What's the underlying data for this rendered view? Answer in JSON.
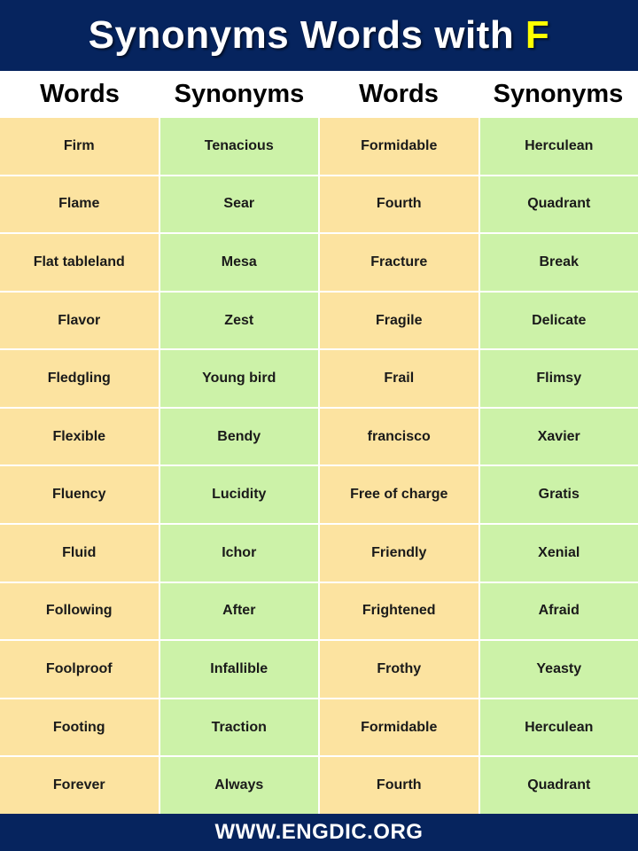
{
  "header": {
    "title_main": "Synonyms Words with ",
    "title_accent": "F",
    "background_color": "#06245e",
    "text_color": "#ffffff",
    "accent_color": "#ffff00"
  },
  "table": {
    "columns": [
      "Words",
      "Synonyms",
      "Words",
      "Synonyms"
    ],
    "word_cell_color": "#fce3a0",
    "synonym_cell_color": "#ccf2a8",
    "rows": [
      {
        "word1": "Firm",
        "synonym1": "Tenacious",
        "word2": "Formidable",
        "synonym2": "Herculean"
      },
      {
        "word1": "Flame",
        "synonym1": "Sear",
        "word2": "Fourth",
        "synonym2": "Quadrant"
      },
      {
        "word1": "Flat tableland",
        "synonym1": "Mesa",
        "word2": "Fracture",
        "synonym2": "Break"
      },
      {
        "word1": "Flavor",
        "synonym1": "Zest",
        "word2": "Fragile",
        "synonym2": "Delicate"
      },
      {
        "word1": "Fledgling",
        "synonym1": "Young bird",
        "word2": "Frail",
        "synonym2": "Flimsy"
      },
      {
        "word1": "Flexible",
        "synonym1": "Bendy",
        "word2": "francisco",
        "synonym2": "Xavier"
      },
      {
        "word1": "Fluency",
        "synonym1": "Lucidity",
        "word2": "Free of charge",
        "synonym2": "Gratis"
      },
      {
        "word1": "Fluid",
        "synonym1": "Ichor",
        "word2": "Friendly",
        "synonym2": "Xenial"
      },
      {
        "word1": "Following",
        "synonym1": "After",
        "word2": "Frightened",
        "synonym2": "Afraid"
      },
      {
        "word1": "Foolproof",
        "synonym1": "Infallible",
        "word2": "Frothy",
        "synonym2": "Yeasty"
      },
      {
        "word1": "Footing",
        "synonym1": "Traction",
        "word2": "Formidable",
        "synonym2": "Herculean"
      },
      {
        "word1": "Forever",
        "synonym1": "Always",
        "word2": "Fourth",
        "synonym2": "Quadrant"
      }
    ]
  },
  "footer": {
    "website": "WWW.ENGDIC.ORG",
    "background_color": "#06245e",
    "text_color": "#ffffff"
  }
}
